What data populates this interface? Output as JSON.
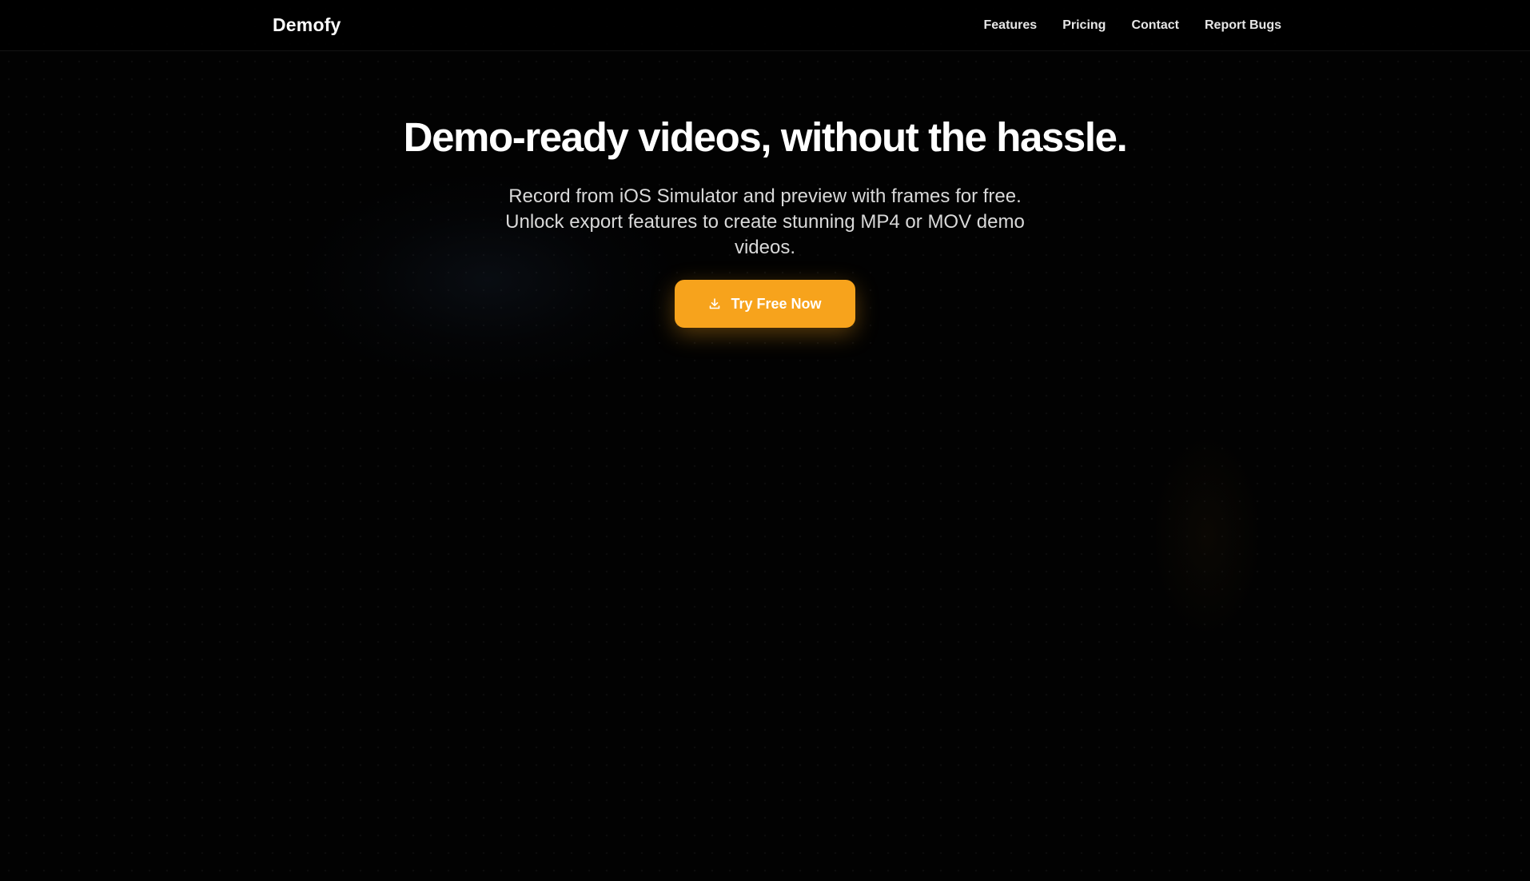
{
  "header": {
    "logo": "Demofy",
    "nav": [
      {
        "label": "Features"
      },
      {
        "label": "Pricing"
      },
      {
        "label": "Contact"
      },
      {
        "label": "Report Bugs"
      }
    ]
  },
  "hero": {
    "title": "Demo-ready videos, without the hassle.",
    "subtitle": "Record from iOS Simulator and preview with frames for free. Unlock export features to create stunning MP4 or MOV demo videos.",
    "cta": {
      "label": "Try Free Now",
      "icon": "download-icon"
    }
  },
  "colors": {
    "background": "#000000",
    "accent": "#f7a31c",
    "text": "#ffffff"
  }
}
